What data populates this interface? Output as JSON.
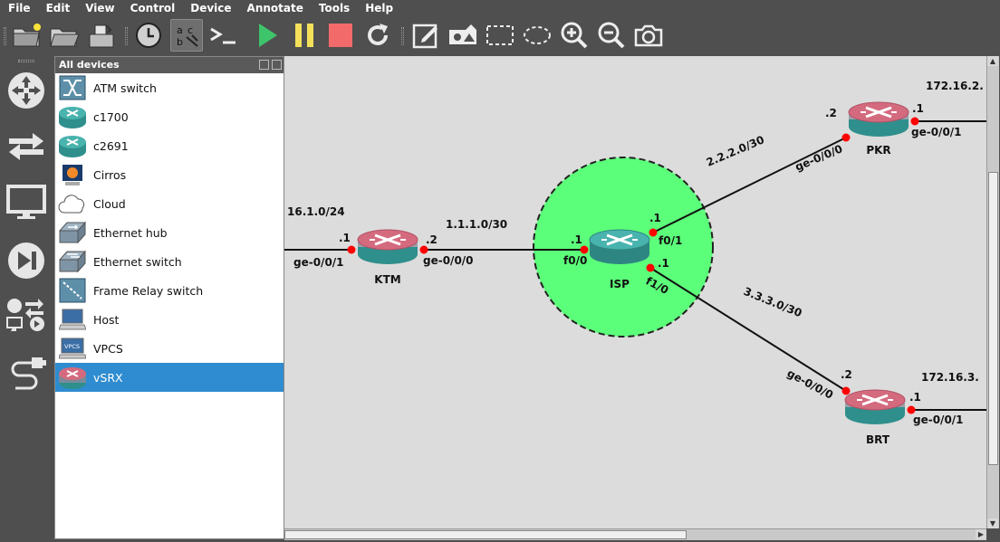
{
  "menu": [
    "File",
    "Edit",
    "View",
    "Control",
    "Device",
    "Annotate",
    "Tools",
    "Help"
  ],
  "toolbar": [
    {
      "name": "new-project",
      "icon": "new-folder-icon"
    },
    {
      "name": "open-project",
      "icon": "open-folder-icon"
    },
    {
      "name": "save-project",
      "icon": "save-icon"
    },
    {
      "name": "snapshot",
      "icon": "clock-icon"
    },
    {
      "name": "show-labels",
      "icon": "abc-icon"
    },
    {
      "name": "console-all",
      "icon": "terminal-icon"
    },
    {
      "name": "start-all",
      "icon": "play-icon"
    },
    {
      "name": "suspend-all",
      "icon": "pause-icon"
    },
    {
      "name": "stop-all",
      "icon": "stop-icon"
    },
    {
      "name": "reload-all",
      "icon": "reload-icon"
    },
    {
      "name": "add-note",
      "icon": "note-icon"
    },
    {
      "name": "insert-picture",
      "icon": "picture-icon"
    },
    {
      "name": "draw-rectangle",
      "icon": "rectangle-icon"
    },
    {
      "name": "draw-ellipse",
      "icon": "ellipse-icon"
    },
    {
      "name": "zoom-in",
      "icon": "zoom-in-icon"
    },
    {
      "name": "zoom-out",
      "icon": "zoom-out-icon"
    },
    {
      "name": "screenshot",
      "icon": "camera-icon"
    }
  ],
  "dock": {
    "title": "All devices",
    "devices": [
      {
        "label": "ATM switch",
        "icon": "atm-switch-icon"
      },
      {
        "label": "c1700",
        "icon": "router-icon"
      },
      {
        "label": "c2691",
        "icon": "router-icon"
      },
      {
        "label": "Cirros",
        "icon": "cirros-icon"
      },
      {
        "label": "Cloud",
        "icon": "cloud-icon"
      },
      {
        "label": "Ethernet hub",
        "icon": "ethernet-hub-icon"
      },
      {
        "label": "Ethernet switch",
        "icon": "ethernet-switch-icon"
      },
      {
        "label": "Frame Relay switch",
        "icon": "frame-relay-icon"
      },
      {
        "label": "Host",
        "icon": "host-icon"
      },
      {
        "label": "VPCS",
        "icon": "vpcs-icon"
      },
      {
        "label": "vSRX",
        "icon": "vsrx-icon",
        "selected": true
      }
    ]
  },
  "topology": {
    "nodes": {
      "ktm": "KTM",
      "isp": "ISP",
      "pkr": "PKR",
      "brt": "BRT"
    },
    "subnets": {
      "ktm_lan": "16.1.0/24",
      "ktm_isp": "1.1.1.0/30",
      "isp_pkr": "2.2.2.0/30",
      "isp_brt": "3.3.3.0/30",
      "pkr_lan": "172.16.2.",
      "brt_lan": "172.16.3."
    },
    "labels": {
      "ktm_left_ip": ".1",
      "ktm_left_if": "ge-0/0/1",
      "ktm_right_ip": ".2",
      "ktm_right_if": "ge-0/0/0",
      "isp_f00_ip": ".1",
      "isp_f00_if": "f0/0",
      "isp_f01_ip": ".1",
      "isp_f01_if": "f0/1",
      "isp_f10_ip": ".1",
      "isp_f10_if": "f1/0",
      "pkr_in_ip": ".2",
      "pkr_in_if": "ge-0/0/0",
      "pkr_out_ip": ".1",
      "pkr_out_if": "ge-0/0/1",
      "brt_in_ip": ".2",
      "brt_in_if": "ge-0/0/0",
      "brt_out_ip": ".1",
      "brt_out_if": "ge-0/0/1"
    },
    "colors": {
      "canvas": "#dcdcdc",
      "ellipse_fill": "#5cff7a",
      "link": "#111111",
      "port": "#ff0000",
      "router_top": "#d46a7e",
      "router_body": "#2f8f8c"
    }
  }
}
